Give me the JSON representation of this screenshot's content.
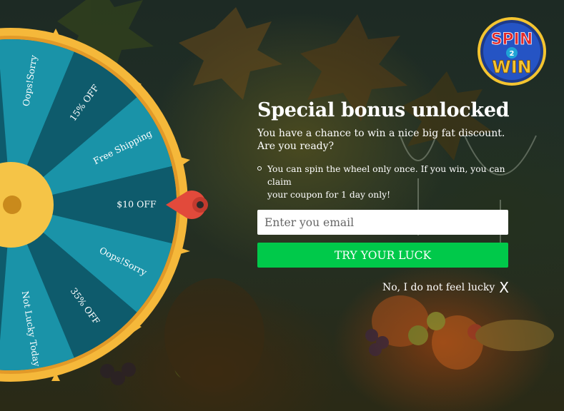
{
  "wheel": {
    "segments": [
      "Oops!Sorry",
      "15% OFF",
      "Free Shipping",
      "$10 OFF",
      "Oops!Sorry",
      "35% OFF",
      "Not Lucky Today"
    ]
  },
  "logo": {
    "line1": "SPIN",
    "line2": "2",
    "line3": "WIN"
  },
  "main": {
    "title": "Special bonus unlocked",
    "subtitle_line1": "You have a chance to win a nice big fat discount.",
    "subtitle_line2": "Are you ready?",
    "rule_line1": "You can spin the wheel only once. If you win, you can claim",
    "rule_line2": "your coupon for 1 day only!",
    "email_placeholder": "Enter you email",
    "email_value": "",
    "button_label": "TRY YOUR LUCK",
    "decline_label": "No, I do not feel lucky",
    "decline_icon": "X"
  },
  "colors": {
    "button": "#00c94a",
    "wheel_light": "#1a93a8",
    "wheel_dark": "#0e5b6c",
    "wheel_rim": "#f5b83a",
    "pointer": "#e24a3b"
  }
}
